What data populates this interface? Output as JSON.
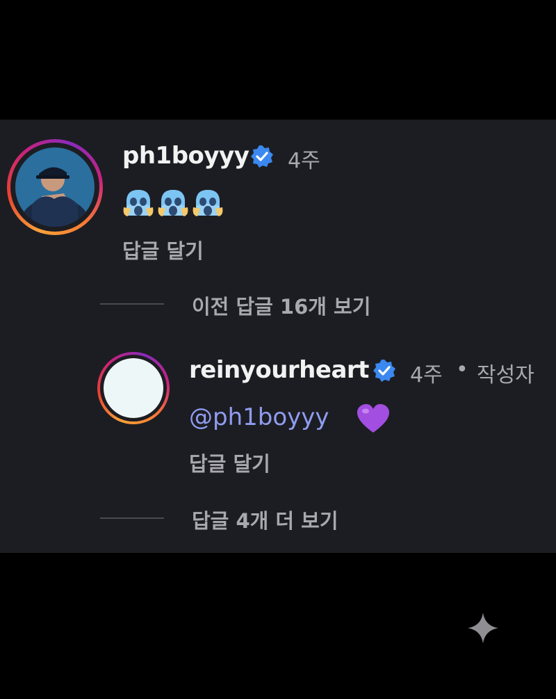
{
  "comment": {
    "username": "ph1boyyy",
    "time": "4주",
    "emoji_count": 3,
    "emoji_name": "face-screaming-in-fear-emoji",
    "reply_label": "답글 달기"
  },
  "view_previous": "이전 답글 16개 보기",
  "reply": {
    "username": "reinyourheart",
    "time": "4주",
    "separator": "•",
    "author_badge": "작성자",
    "mention": "@ph1boyyy",
    "heart_color": "#a24ee0",
    "reply_label": "답글 달기"
  },
  "view_more": "답글 4개 더 보기",
  "colors": {
    "background": "#1c1d22",
    "verified": "#3b88f0",
    "mention": "#8f9cf0",
    "muted_text": "#a8a8ae"
  }
}
